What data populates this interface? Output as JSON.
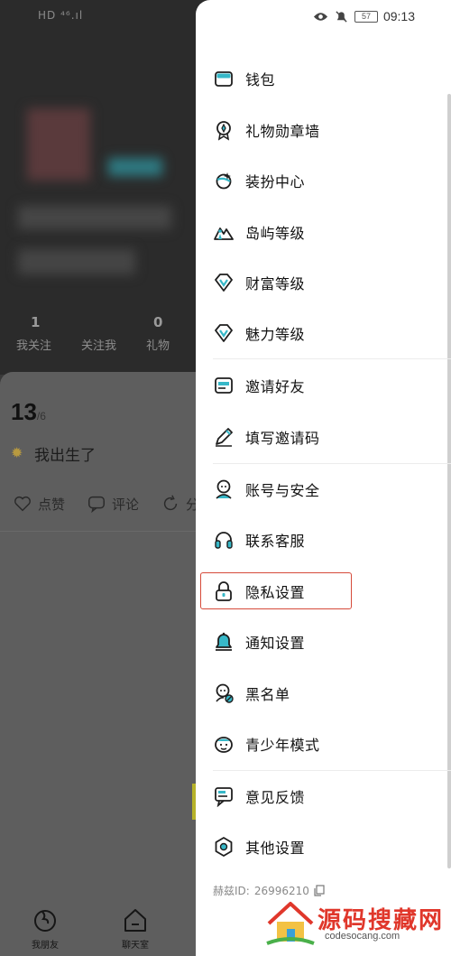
{
  "background": {
    "status_left": "HD ⁴⁶.ıl",
    "stats": [
      {
        "num": "1",
        "label": "我关注"
      },
      {
        "num": "",
        "label": "关注我"
      },
      {
        "num": "0",
        "label": "礼物"
      }
    ],
    "post": {
      "count": "13",
      "total": "/6",
      "text": "我出生了"
    },
    "actions": [
      {
        "icon": "heart-icon",
        "label": "点赞"
      },
      {
        "icon": "comment-icon",
        "label": "评论"
      },
      {
        "icon": "share-icon",
        "label": "分"
      }
    ],
    "bottom_nav": [
      {
        "icon": "friend-icon",
        "label": "我朋友"
      },
      {
        "icon": "chat-room-icon",
        "label": "聊天室"
      }
    ]
  },
  "status_bar": {
    "battery": "57",
    "time": "09:13"
  },
  "menu": [
    {
      "key": "wallet",
      "label": "钱包",
      "icon": "wallet-icon"
    },
    {
      "key": "gift-medal-wall",
      "label": "礼物勋章墙",
      "icon": "medal-icon"
    },
    {
      "key": "dress-center",
      "label": "装扮中心",
      "icon": "planet-icon"
    },
    {
      "key": "island-level",
      "label": "岛屿等级",
      "icon": "island-icon"
    },
    {
      "key": "wealth-level",
      "label": "财富等级",
      "icon": "diamond-icon"
    },
    {
      "key": "charm-level",
      "label": "魅力等级",
      "icon": "diamond-icon"
    },
    {
      "key": "invite-friends",
      "label": "邀请好友",
      "icon": "mail-icon"
    },
    {
      "key": "enter-invite-code",
      "label": "填写邀请码",
      "icon": "pencil-icon"
    },
    {
      "key": "account-security",
      "label": "账号与安全",
      "icon": "user-shield-icon"
    },
    {
      "key": "contact-support",
      "label": "联系客服",
      "icon": "headset-icon"
    },
    {
      "key": "privacy-settings",
      "label": "隐私设置",
      "icon": "lock-icon"
    },
    {
      "key": "notification-settings",
      "label": "通知设置",
      "icon": "bell-icon"
    },
    {
      "key": "blacklist",
      "label": "黑名单",
      "icon": "block-user-icon"
    },
    {
      "key": "teen-mode",
      "label": "青少年模式",
      "icon": "teen-icon"
    },
    {
      "key": "feedback",
      "label": "意见反馈",
      "icon": "feedback-icon"
    },
    {
      "key": "other-settings",
      "label": "其他设置",
      "icon": "settings-icon"
    }
  ],
  "user_id": {
    "label": "赫兹ID: ",
    "value": "26996210"
  },
  "watermark": {
    "title": "源码搜藏网",
    "url": "codesocang.com"
  },
  "colors": {
    "accent": "#37b8c8",
    "highlight_border": "#d64a3a"
  }
}
